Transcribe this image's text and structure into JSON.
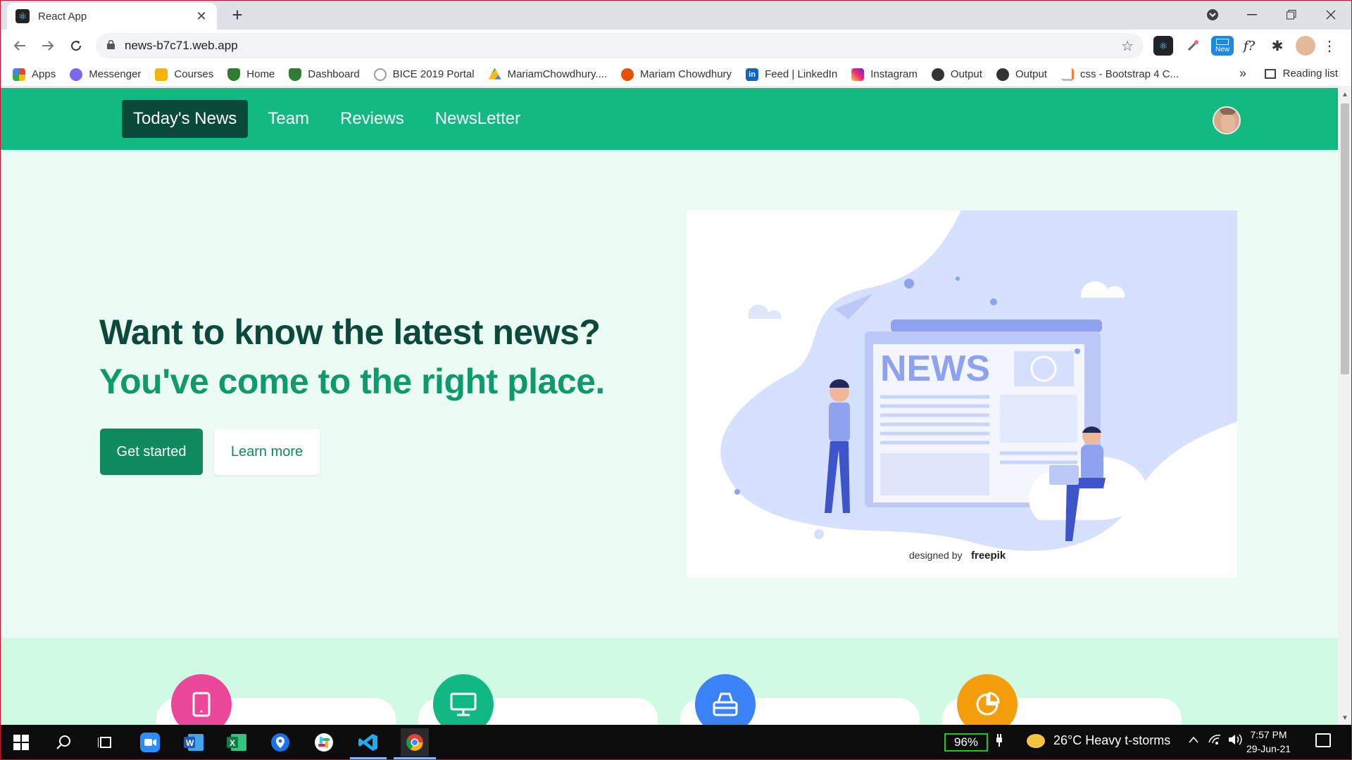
{
  "browser": {
    "tab_title": "React App",
    "tab_close": "✕",
    "new_tab": "+",
    "url": "news-b7c71.web.app",
    "bookmarks": [
      {
        "label": "Apps",
        "color": "#ea4335"
      },
      {
        "label": "Messenger",
        "color": "#7b68ee"
      },
      {
        "label": "Courses",
        "color": "#f4b400"
      },
      {
        "label": "Home",
        "color": "#2e7d32"
      },
      {
        "label": "Dashboard",
        "color": "#2e7d32"
      },
      {
        "label": "BICE 2019 Portal",
        "color": "#9e9e9e"
      },
      {
        "label": "MariamChowdhury....",
        "color": "#1e88e5"
      },
      {
        "label": "Mariam Chowdhury",
        "color": "#e65100"
      },
      {
        "label": "Feed | LinkedIn",
        "color": "#0a66c2"
      },
      {
        "label": "Instagram",
        "color": "#d62976"
      },
      {
        "label": "Output",
        "color": "#333333"
      },
      {
        "label": "Output",
        "color": "#333333"
      },
      {
        "label": "css - Bootstrap 4 C...",
        "color": "#f48024"
      }
    ],
    "more_bookmarks": "»",
    "reading_list": "Reading list",
    "extension_new_badge": "New"
  },
  "page": {
    "nav": {
      "items": [
        "Today's News",
        "Team",
        "Reviews",
        "NewsLetter"
      ],
      "active_index": 0
    },
    "hero": {
      "heading": "Want to know the latest news?",
      "subheading": "You've come to the right place.",
      "primary_button": "Get started",
      "secondary_button": "Learn more"
    },
    "illustration": {
      "headline": "NEWS",
      "credit_prefix": "designed by",
      "credit_brand": "freepik"
    },
    "feature_icons": [
      {
        "icon": "tablet-icon",
        "color": "#ec4899"
      },
      {
        "icon": "desktop-icon",
        "color": "#10b981"
      },
      {
        "icon": "database-icon",
        "color": "#3b82f6"
      },
      {
        "icon": "pie-chart-icon",
        "color": "#f59e0b"
      }
    ]
  },
  "taskbar": {
    "battery": "96%",
    "weather": "26°C  Heavy t-storms",
    "time": "7:57 PM",
    "date": "29-Jun-21"
  },
  "colors": {
    "nav_bg": "#12b981",
    "nav_active": "#0b4a3a",
    "hero_bg": "#ebfcf4",
    "primary_button": "#0e8a5e",
    "heading_dark": "#0b4a3a",
    "heading_green": "#0e9a6a"
  }
}
